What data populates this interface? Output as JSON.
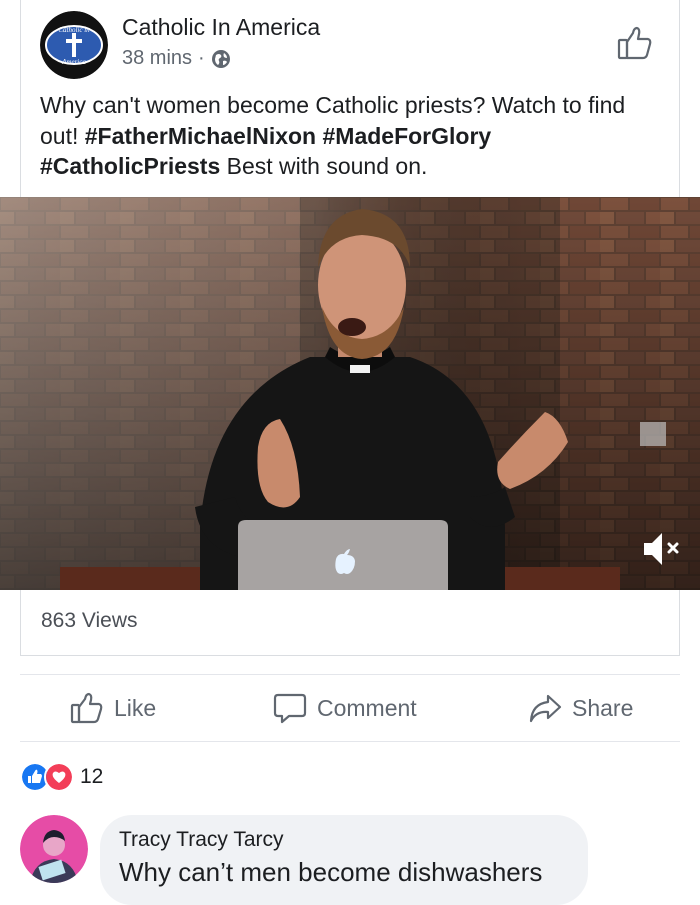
{
  "post": {
    "page_name": "Catholic In America",
    "time": "38 mins",
    "separator": "·",
    "logo_text_top": "Catholic in",
    "logo_text_bottom": "America",
    "text_parts": [
      "Why can't women become Catholic priests? Watch to find out! ",
      "#FatherMichaelNixon",
      " ",
      "#MadeForGlory",
      " ",
      "#CatholicPriests",
      " Best with sound on."
    ],
    "views": "863 Views"
  },
  "actions": {
    "like": "Like",
    "comment": "Comment",
    "share": "Share"
  },
  "reactions": {
    "count": "12"
  },
  "comment": {
    "author": "Tracy Tracy Tarcy",
    "text": "Why can’t men become dishwashers"
  },
  "icons": {
    "globe": "globe-icon",
    "thumbs_up": "thumbs-up-icon",
    "comment": "speech-bubble-icon",
    "share": "share-arrow-icon",
    "mute": "muted-speaker-icon"
  },
  "colors": {
    "fb_blue": "#1877f2",
    "love_red": "#f33e58",
    "text_secondary": "#606770",
    "bubble_bg": "#f0f2f5"
  }
}
